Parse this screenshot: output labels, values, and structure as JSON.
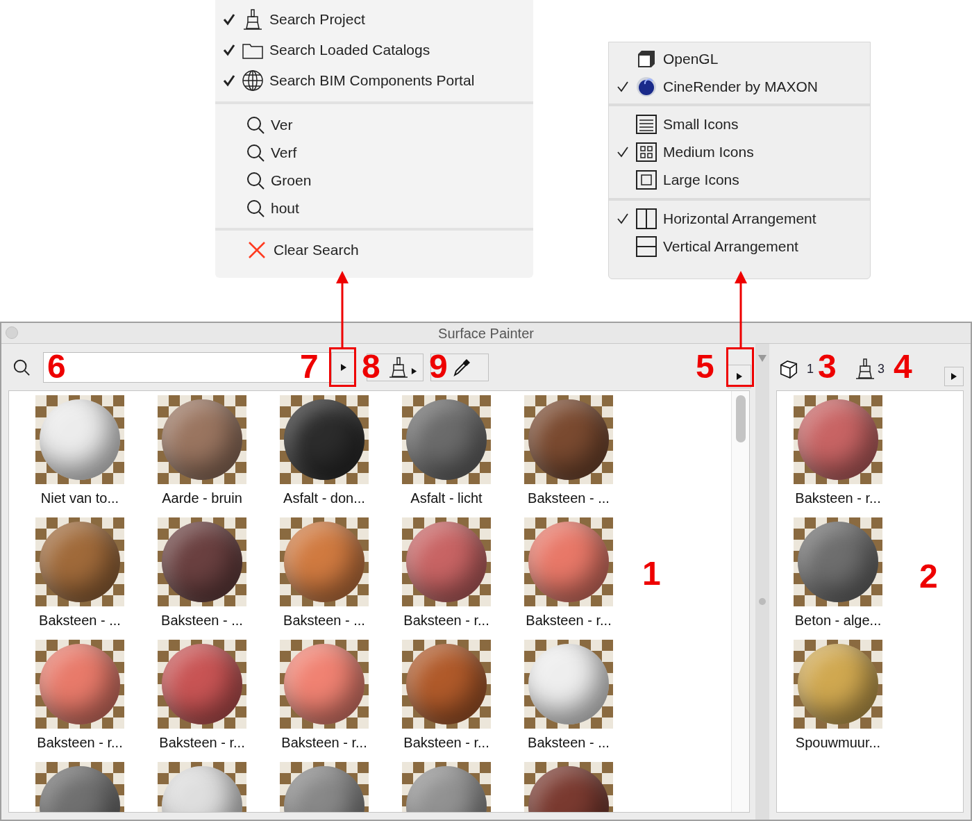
{
  "search_menu": {
    "sources": [
      {
        "label": "Search Project",
        "checked": true,
        "kind": "brush"
      },
      {
        "label": "Search Loaded Catalogs",
        "checked": true,
        "kind": "folder"
      },
      {
        "label": "Search BIM Components Portal",
        "checked": true,
        "kind": "globe"
      }
    ],
    "recent": [
      {
        "label": "Ver"
      },
      {
        "label": "Verf"
      },
      {
        "label": "Groen"
      },
      {
        "label": "hout"
      }
    ],
    "clear": {
      "label": "Clear Search"
    }
  },
  "view_menu": {
    "sections": [
      [
        {
          "label": "OpenGL",
          "checked": false,
          "kind": "cube"
        },
        {
          "label": "CineRender by MAXON",
          "checked": true,
          "kind": "render"
        }
      ],
      [
        {
          "label": "Small Icons",
          "checked": false,
          "kind": "small"
        },
        {
          "label": "Medium Icons",
          "checked": true,
          "kind": "medium"
        },
        {
          "label": "Large Icons",
          "checked": false,
          "kind": "large"
        }
      ],
      [
        {
          "label": "Horizontal Arrangement",
          "checked": true,
          "kind": "horizontal"
        },
        {
          "label": "Vertical Arrangement",
          "checked": false,
          "kind": "vertical"
        }
      ]
    ]
  },
  "window": {
    "title": "Surface Painter"
  },
  "counts": [
    {
      "kind": "cube",
      "value": "1"
    },
    {
      "kind": "brush",
      "value": "3"
    }
  ],
  "materials": [
    {
      "label": "Niet van to...",
      "color": "#ececec"
    },
    {
      "label": "Aarde - bruin",
      "color": "#9a7560"
    },
    {
      "label": "Asfalt - don...",
      "color": "#2c2c2c"
    },
    {
      "label": "Asfalt - licht",
      "color": "#6b6b6b"
    },
    {
      "label": "Baksteen - ...",
      "color": "#7a4a30"
    },
    {
      "label": "Baksteen - ...",
      "color": "#a06a3a"
    },
    {
      "label": "Baksteen - ...",
      "color": "#6a4040"
    },
    {
      "label": "Baksteen - ...",
      "color": "#d07a40"
    },
    {
      "label": "Baksteen - r...",
      "color": "#c86464"
    },
    {
      "label": "Baksteen - r...",
      "color": "#e87868"
    },
    {
      "label": "Baksteen - r...",
      "color": "#e87a6a"
    },
    {
      "label": "Baksteen - r...",
      "color": "#c85454"
    },
    {
      "label": "Baksteen - r...",
      "color": "#f08272"
    },
    {
      "label": "Baksteen - r...",
      "color": "#b05a2a"
    },
    {
      "label": "Baksteen - ...",
      "color": "#eeeeee"
    },
    {
      "color": "#707070"
    },
    {
      "color": "#dedede"
    },
    {
      "color": "#888888"
    },
    {
      "color": "#929292"
    },
    {
      "color": "#7a3a30"
    }
  ],
  "picked": [
    {
      "label": "Baksteen - r...",
      "color": "#c86464"
    },
    {
      "label": "Beton - alge...",
      "color": "#6e6e6e"
    },
    {
      "label": "Spouwmuur...",
      "color": "#d0a850"
    }
  ],
  "annotations": [
    {
      "label": "6"
    },
    {
      "label": "7"
    },
    {
      "label": "8"
    },
    {
      "label": "9"
    },
    {
      "label": "5"
    },
    {
      "label": "3"
    },
    {
      "label": "4"
    },
    {
      "label": "1"
    },
    {
      "label": "2"
    }
  ]
}
